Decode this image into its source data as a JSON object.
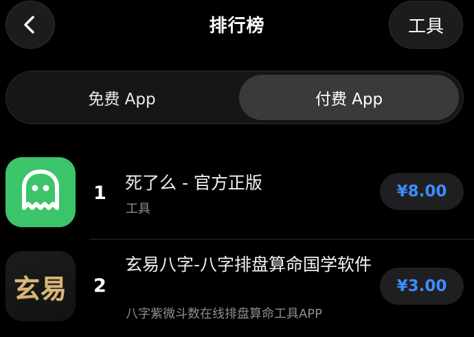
{
  "header": {
    "title": "排行榜",
    "tools_label": "工具"
  },
  "segment": {
    "free_label": "免费 App",
    "paid_label": "付费 App",
    "selected": "paid"
  },
  "apps": [
    {
      "rank": "1",
      "name": "死了么 - 官方正版",
      "subtitle": "工具",
      "price": "¥8.00",
      "icon": "ghost-icon"
    },
    {
      "rank": "2",
      "name": "玄易八字-八字排盘算命国学软件",
      "subtitle": "八字紫微斗数在线排盘算命工具APP",
      "price": "¥3.00",
      "icon_text": "玄易"
    }
  ],
  "colors": {
    "accent": "#3d8cff",
    "ghost_icon_bg": "#3cc46b"
  }
}
